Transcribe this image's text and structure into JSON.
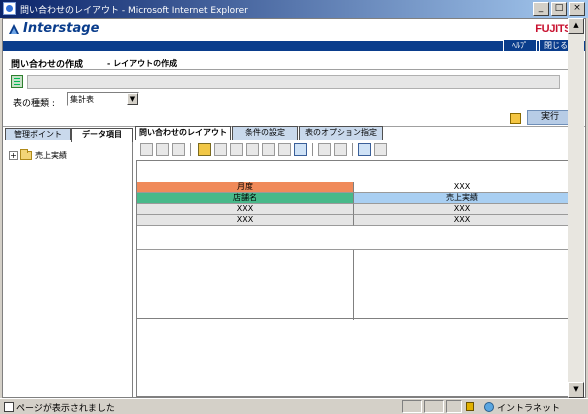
{
  "window": {
    "title": "問い合わせのレイアウト - Microsoft Internet Explorer",
    "min_label": "_",
    "max_label": "□",
    "close_label": "×"
  },
  "brand": {
    "product": "Interstage",
    "company": "FUJITSU",
    "help_label": "ﾍﾙﾌﾟ",
    "close_label": "閉じる"
  },
  "page": {
    "title": "問い合わせの作成",
    "subtitle": "- レイアウトの作成"
  },
  "table_type": {
    "label": "表の種類 :",
    "selected": "集計表"
  },
  "run_button": "実行",
  "tabs": [
    {
      "label": "問い合わせのレイアウト",
      "active": true
    },
    {
      "label": "条件の設定",
      "active": false
    },
    {
      "label": "表のオプション指定",
      "active": false
    }
  ],
  "left_tabs": [
    {
      "label": "管理ポイント",
      "active": false
    },
    {
      "label": "データ項目",
      "active": true
    }
  ],
  "tree": {
    "expand": "+",
    "item": "売上実績"
  },
  "toolbar_icons": [
    "insert-row-icon",
    "insert-column-icon",
    "delete-icon",
    "chart-icon",
    "align-icon",
    "move-row-icon",
    "move-column-icon",
    "paste-icon",
    "clear-icon",
    "table-layout-icon",
    "zoom-icon",
    "search-icon",
    "preview-icon",
    "grid-icon"
  ],
  "layout": {
    "row1": {
      "left": "月度",
      "right": "XXX"
    },
    "row2": {
      "left": "店舗名",
      "right": "売上実績"
    },
    "row3": {
      "left": "XXX",
      "right": "XXX"
    },
    "row4": {
      "left": "XXX",
      "right": "XXX"
    }
  },
  "colors": {
    "header_orange": "#f08a5a",
    "header_green": "#48b98a",
    "header_blue": "#a9cff2",
    "gray_cell": "#e5e5e5",
    "brand_blue": "#0a3d8c",
    "brand_red": "#c8102e"
  },
  "statusbar": {
    "message": "ページが表示されました",
    "zone": "イントラネット"
  }
}
